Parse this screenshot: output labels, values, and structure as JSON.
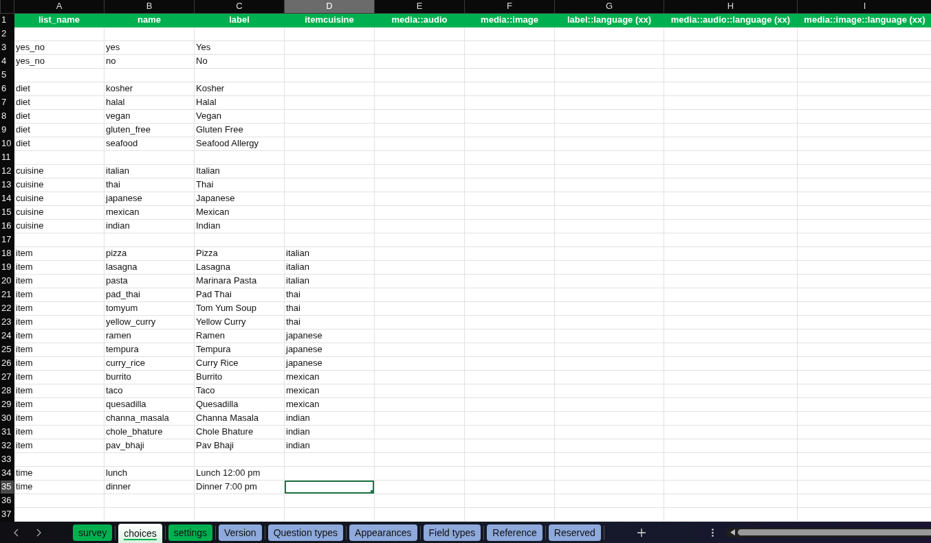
{
  "columns": [
    {
      "letter": "A",
      "selected": false
    },
    {
      "letter": "B",
      "selected": false
    },
    {
      "letter": "C",
      "selected": false
    },
    {
      "letter": "D",
      "selected": true
    },
    {
      "letter": "E",
      "selected": false
    },
    {
      "letter": "F",
      "selected": false
    },
    {
      "letter": "G",
      "selected": false
    },
    {
      "letter": "H",
      "selected": false
    },
    {
      "letter": "I",
      "selected": false
    }
  ],
  "header_row": {
    "number": "1",
    "cells": [
      "list_name",
      "name",
      "label",
      "itemcuisine",
      "media::audio",
      "media::image",
      "label::language (xx)",
      "media::audio::language (xx)",
      "media::image::language (xx)"
    ]
  },
  "rows": [
    {
      "number": "2",
      "selected": false
    },
    {
      "number": "3",
      "selected": false,
      "cells": [
        "yes_no",
        "yes",
        "Yes"
      ]
    },
    {
      "number": "4",
      "selected": false,
      "cells": [
        "yes_no",
        "no",
        "No"
      ]
    },
    {
      "number": "5",
      "selected": false
    },
    {
      "number": "6",
      "selected": false,
      "cells": [
        "diet",
        "kosher",
        "Kosher"
      ]
    },
    {
      "number": "7",
      "selected": false,
      "cells": [
        "diet",
        "halal",
        "Halal"
      ]
    },
    {
      "number": "8",
      "selected": false,
      "cells": [
        "diet",
        "vegan",
        "Vegan"
      ]
    },
    {
      "number": "9",
      "selected": false,
      "cells": [
        "diet",
        "gluten_free",
        "Gluten Free"
      ]
    },
    {
      "number": "10",
      "selected": false,
      "cells": [
        "diet",
        "seafood",
        "Seafood Allergy"
      ]
    },
    {
      "number": "11",
      "selected": false
    },
    {
      "number": "12",
      "selected": false,
      "cells": [
        "cuisine",
        "italian",
        "Italian"
      ]
    },
    {
      "number": "13",
      "selected": false,
      "cells": [
        "cuisine",
        "thai",
        "Thai"
      ]
    },
    {
      "number": "14",
      "selected": false,
      "cells": [
        "cuisine",
        "japanese",
        "Japanese"
      ]
    },
    {
      "number": "15",
      "selected": false,
      "cells": [
        "cuisine",
        "mexican",
        "Mexican"
      ]
    },
    {
      "number": "16",
      "selected": false,
      "cells": [
        "cuisine",
        "indian",
        "Indian"
      ]
    },
    {
      "number": "17",
      "selected": false
    },
    {
      "number": "18",
      "selected": false,
      "cells": [
        "item",
        "pizza",
        "Pizza",
        "italian"
      ]
    },
    {
      "number": "19",
      "selected": false,
      "cells": [
        "item",
        "lasagna",
        "Lasagna",
        "italian"
      ]
    },
    {
      "number": "20",
      "selected": false,
      "cells": [
        "item",
        "pasta",
        "Marinara Pasta",
        "italian"
      ]
    },
    {
      "number": "21",
      "selected": false,
      "cells": [
        "item",
        "pad_thai",
        "Pad Thai",
        "thai"
      ]
    },
    {
      "number": "22",
      "selected": false,
      "cells": [
        "item",
        "tomyum",
        "Tom Yum Soup",
        "thai"
      ]
    },
    {
      "number": "23",
      "selected": false,
      "cells": [
        "item",
        "yellow_curry",
        "Yellow Curry",
        "thai"
      ]
    },
    {
      "number": "24",
      "selected": false,
      "cells": [
        "item",
        "ramen",
        "Ramen",
        "japanese"
      ]
    },
    {
      "number": "25",
      "selected": false,
      "cells": [
        "item",
        "tempura",
        "Tempura",
        "japanese"
      ]
    },
    {
      "number": "26",
      "selected": false,
      "cells": [
        "item",
        "curry_rice",
        "Curry Rice",
        "japanese"
      ]
    },
    {
      "number": "27",
      "selected": false,
      "cells": [
        "item",
        "burrito",
        "Burrito",
        "mexican"
      ]
    },
    {
      "number": "28",
      "selected": false,
      "cells": [
        "item",
        "taco",
        "Taco",
        "mexican"
      ]
    },
    {
      "number": "29",
      "selected": false,
      "cells": [
        "item",
        "quesadilla",
        "Quesadilla",
        "mexican"
      ]
    },
    {
      "number": "30",
      "selected": false,
      "cells": [
        "item",
        "channa_masala",
        "Channa Masala",
        "indian"
      ]
    },
    {
      "number": "31",
      "selected": false,
      "cells": [
        "item",
        "chole_bhature",
        "Chole Bhature",
        "indian"
      ]
    },
    {
      "number": "32",
      "selected": false,
      "cells": [
        "item",
        "pav_bhaji",
        "Pav Bhaji",
        "indian"
      ]
    },
    {
      "number": "33",
      "selected": false
    },
    {
      "number": "34",
      "selected": false,
      "cells": [
        "time",
        "lunch",
        "Lunch 12:00 pm"
      ]
    },
    {
      "number": "35",
      "selected": true,
      "cells": [
        "time",
        "dinner",
        "Dinner 7:00 pm"
      ]
    },
    {
      "number": "36",
      "selected": false
    },
    {
      "number": "37",
      "selected": false
    }
  ],
  "sheet_tabs": [
    {
      "label": "survey",
      "color": "#00b050",
      "selected": false
    },
    {
      "label": "choices",
      "color": "#00b050",
      "selected": true
    },
    {
      "label": "settings",
      "color": "#00b050",
      "selected": false
    },
    {
      "label": "Version",
      "color": "#8ea9db",
      "selected": false
    },
    {
      "label": "Question types",
      "color": "#8ea9db",
      "selected": false
    },
    {
      "label": "Appearances",
      "color": "#8ea9db",
      "selected": false
    },
    {
      "label": "Field types",
      "color": "#8ea9db",
      "selected": false
    },
    {
      "label": "Reference",
      "color": "#8ea9db",
      "selected": false
    },
    {
      "label": "Reserved",
      "color": "#8ea9db",
      "selected": false
    }
  ]
}
